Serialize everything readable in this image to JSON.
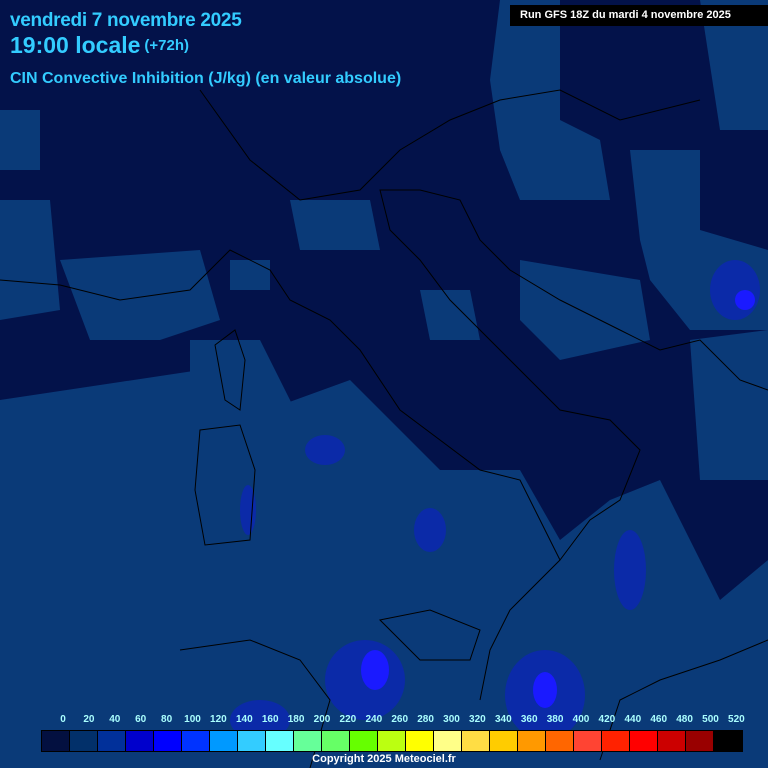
{
  "header": {
    "date": "vendredi 7 novembre 2025",
    "time": "19:00 locale",
    "lead": "(+72h)",
    "parameter": "CIN Convective Inhibition (J/kg) (en valeur absolue)",
    "run": "Run GFS 18Z du mardi 4 novembre 2025"
  },
  "legend": {
    "labels": [
      "0",
      "20",
      "40",
      "60",
      "80",
      "100",
      "120",
      "140",
      "160",
      "180",
      "200",
      "220",
      "240",
      "260",
      "280",
      "300",
      "320",
      "340",
      "360",
      "380",
      "400",
      "420",
      "440",
      "460",
      "480",
      "500",
      "520"
    ],
    "colors": [
      "#031040",
      "#02306a",
      "#01309a",
      "#0000cc",
      "#0000ff",
      "#0033ff",
      "#0099ff",
      "#33ccff",
      "#66ffff",
      "#66ff99",
      "#66ff66",
      "#66ff00",
      "#bbff11",
      "#ffff00",
      "#ffff88",
      "#ffdd44",
      "#ffcc00",
      "#ff9900",
      "#ff6600",
      "#ff4433",
      "#ff2200",
      "#ff0000",
      "#cc0000",
      "#990000",
      "#660000",
      "#550000",
      "#000000"
    ]
  },
  "copyright": "Copyright 2025 Meteociel.fr",
  "colors": {
    "background": "#03124a",
    "low": "#0a3a78",
    "mid": "#0b2aa8",
    "high": "#1a1aff"
  }
}
